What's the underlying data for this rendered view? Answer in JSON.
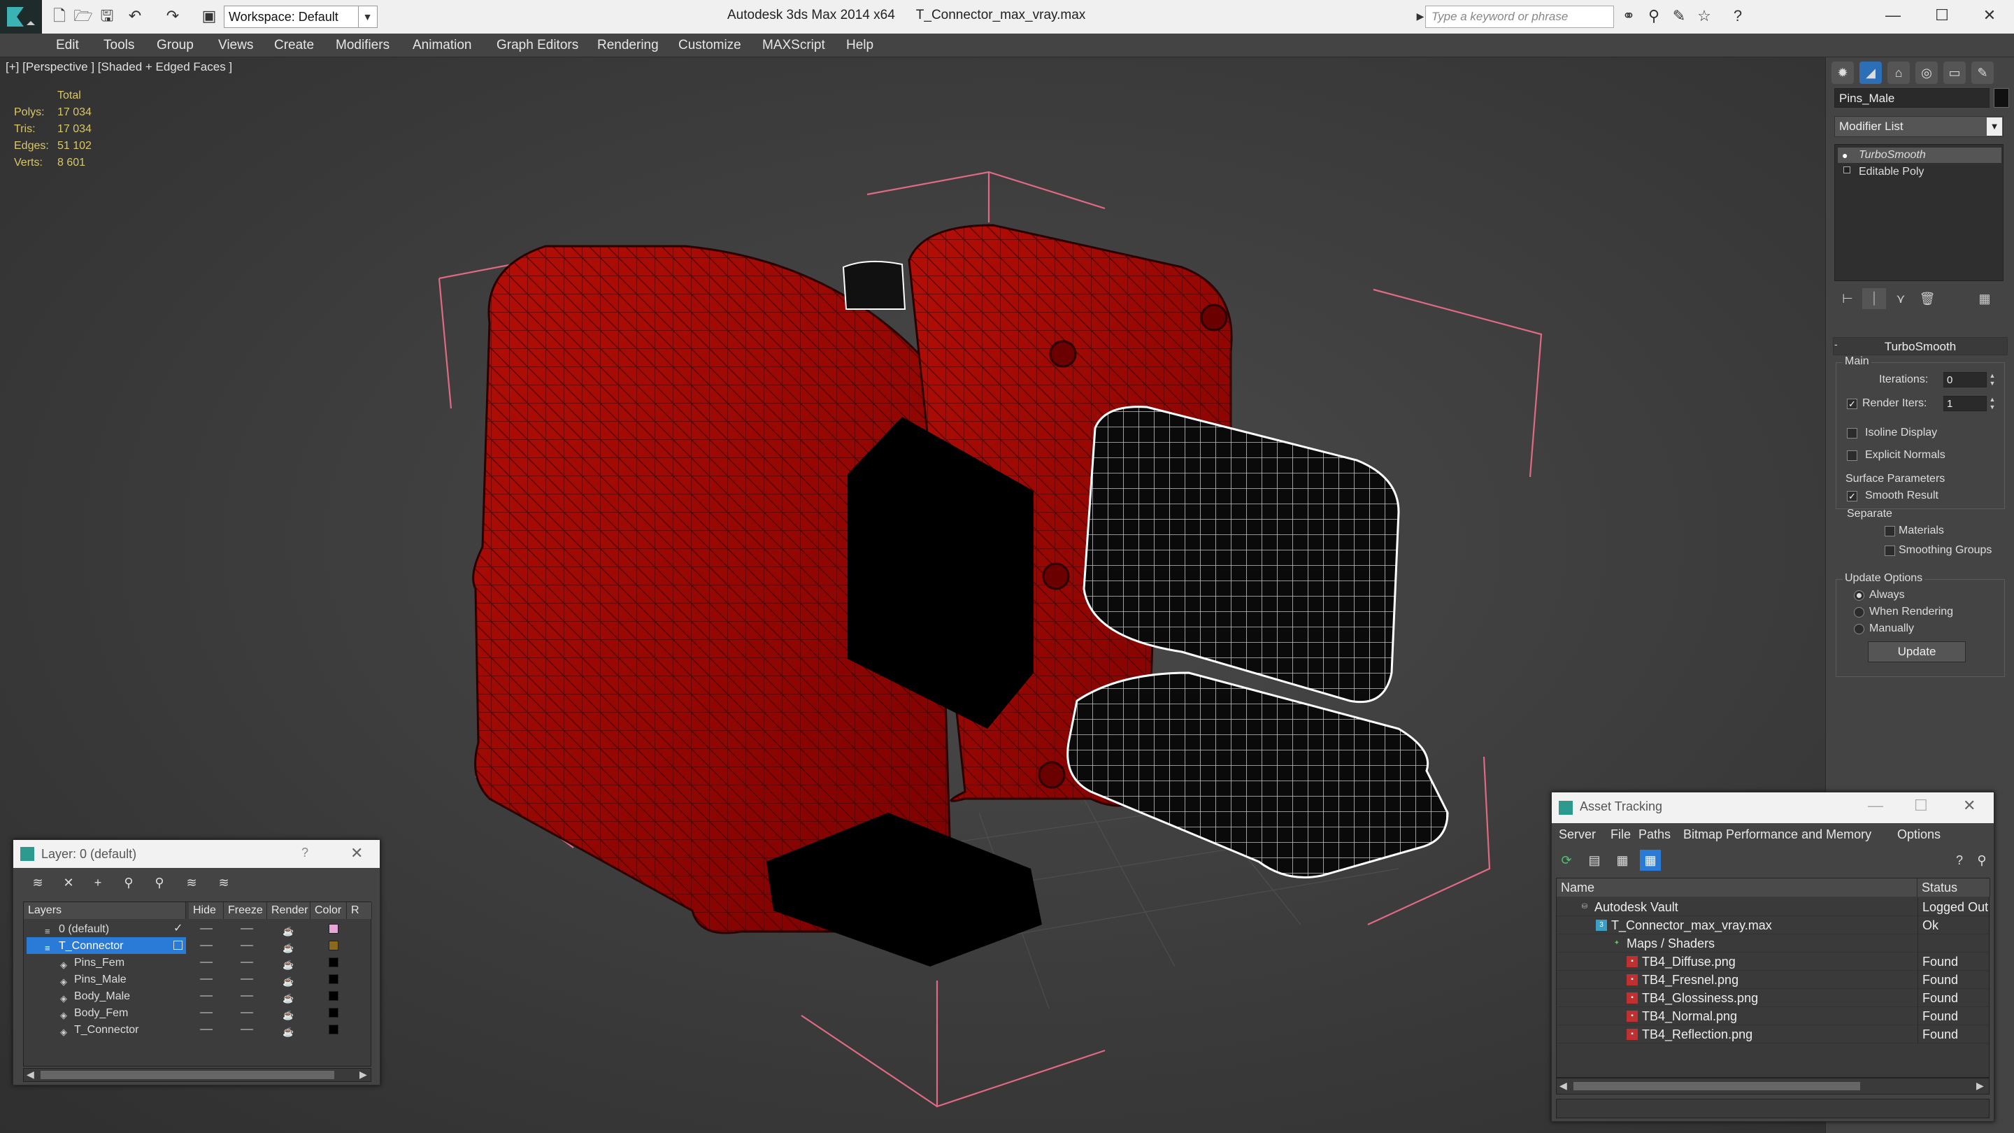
{
  "titlebar": {
    "app": "Autodesk 3ds Max  2014 x64",
    "file": "T_Connector_max_vray.max",
    "workspace": "Workspace: Default",
    "search_placeholder": "Type a keyword or phrase"
  },
  "menu": [
    "Edit",
    "Tools",
    "Group",
    "Views",
    "Create",
    "Modifiers",
    "Animation",
    "Graph Editors",
    "Rendering",
    "Customize",
    "MAXScript",
    "Help"
  ],
  "viewport": {
    "label": "[+] [Perspective ] [Shaded + Edged Faces ]",
    "stats": {
      "header": "Total",
      "rows": [
        {
          "label": "Polys:",
          "value": "17 034"
        },
        {
          "label": "Tris:",
          "value": "17 034"
        },
        {
          "label": "Edges:",
          "value": "51 102"
        },
        {
          "label": "Verts:",
          "value": "8 601"
        }
      ]
    }
  },
  "command_panel": {
    "object_name": "Pins_Male",
    "modifier_list": "Modifier List",
    "stack": [
      "TurboSmooth",
      "Editable Poly"
    ],
    "rollout": {
      "title": "TurboSmooth",
      "main_label": "Main",
      "iterations_label": "Iterations:",
      "iterations_value": "0",
      "render_iters_label": "Render Iters:",
      "render_iters_value": "1",
      "isoline": "Isoline Display",
      "explicit_normals": "Explicit Normals",
      "surface_params": "Surface Parameters",
      "smooth_result": "Smooth Result",
      "separate": "Separate",
      "materials": "Materials",
      "smoothing_groups": "Smoothing Groups",
      "update_options": "Update Options",
      "always": "Always",
      "when_rendering": "When Rendering",
      "manually": "Manually",
      "update_button": "Update"
    }
  },
  "layer_panel": {
    "title": "Layer: 0 (default)",
    "help": "?",
    "columns": [
      "Layers",
      "Hide",
      "Freeze",
      "Render",
      "Color",
      "R"
    ],
    "rows": [
      {
        "name": "0 (default)",
        "color": "#e8a6d8"
      },
      {
        "name": "T_Connector",
        "color": "#8a6a1a"
      },
      {
        "name": "Pins_Fem",
        "color": "#000000"
      },
      {
        "name": "Pins_Male",
        "color": "#000000"
      },
      {
        "name": "Body_Male",
        "color": "#000000"
      },
      {
        "name": "Body_Fem",
        "color": "#000000"
      },
      {
        "name": "T_Connector",
        "color": "#000000"
      }
    ]
  },
  "asset_panel": {
    "title": "Asset Tracking",
    "menu": [
      "Server",
      "File",
      "Paths",
      "Bitmap Performance and Memory",
      "Options"
    ],
    "columns": [
      "Name",
      "Status"
    ],
    "rows": [
      {
        "name": "Autodesk Vault",
        "status": "Logged Out"
      },
      {
        "name": "T_Connector_max_vray.max",
        "status": "Ok"
      },
      {
        "name": "Maps / Shaders",
        "status": ""
      },
      {
        "name": "TB4_Diffuse.png",
        "status": "Found"
      },
      {
        "name": "TB4_Fresnel.png",
        "status": "Found"
      },
      {
        "name": "TB4_Glossiness.png",
        "status": "Found"
      },
      {
        "name": "TB4_Normal.png",
        "status": "Found"
      },
      {
        "name": "TB4_Reflection.png",
        "status": "Found"
      }
    ]
  }
}
